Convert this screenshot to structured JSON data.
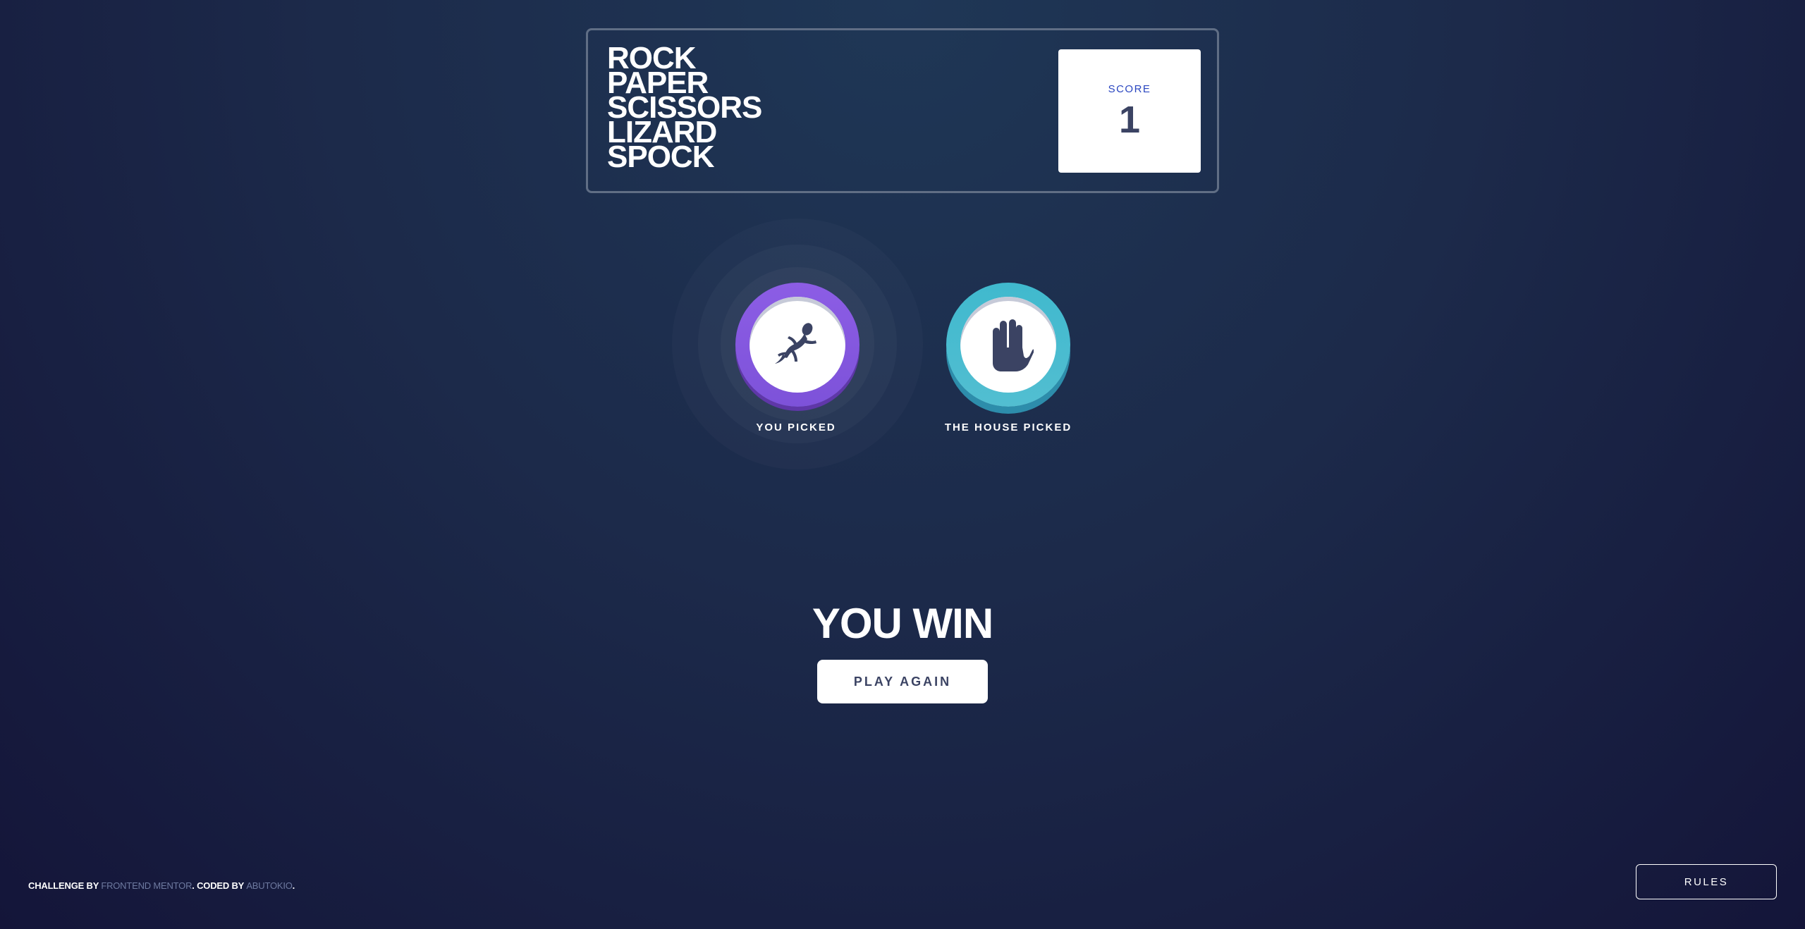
{
  "header": {
    "title_lines": [
      "ROCK",
      "PAPER",
      "SCISSORS",
      "LIZARD",
      "SPOCK"
    ],
    "score_label": "SCORE",
    "score_value": "1"
  },
  "game": {
    "player_pick": {
      "icon": "lizard-icon",
      "label": "YOU PICKED",
      "accent": "#8c5de5"
    },
    "house_pick": {
      "icon": "spock-icon",
      "label": "THE HOUSE PICKED",
      "accent": "#40b9ce"
    },
    "result_text": "YOU WIN",
    "play_again_label": "PLAY AGAIN"
  },
  "footer": {
    "challenge_prefix": "CHALLENGE BY ",
    "challenge_link": "FRONTEND MENTOR",
    "coded_prefix": ". CODED BY ",
    "coded_link": "ABUTOKIO",
    "suffix": ".",
    "rules_label": "RULES"
  },
  "colors": {
    "background_top": "#1f3756",
    "background_bottom": "#141539",
    "header_outline": "#606e85",
    "score_text": "#3b4363",
    "score_label": "#2a46c0"
  }
}
